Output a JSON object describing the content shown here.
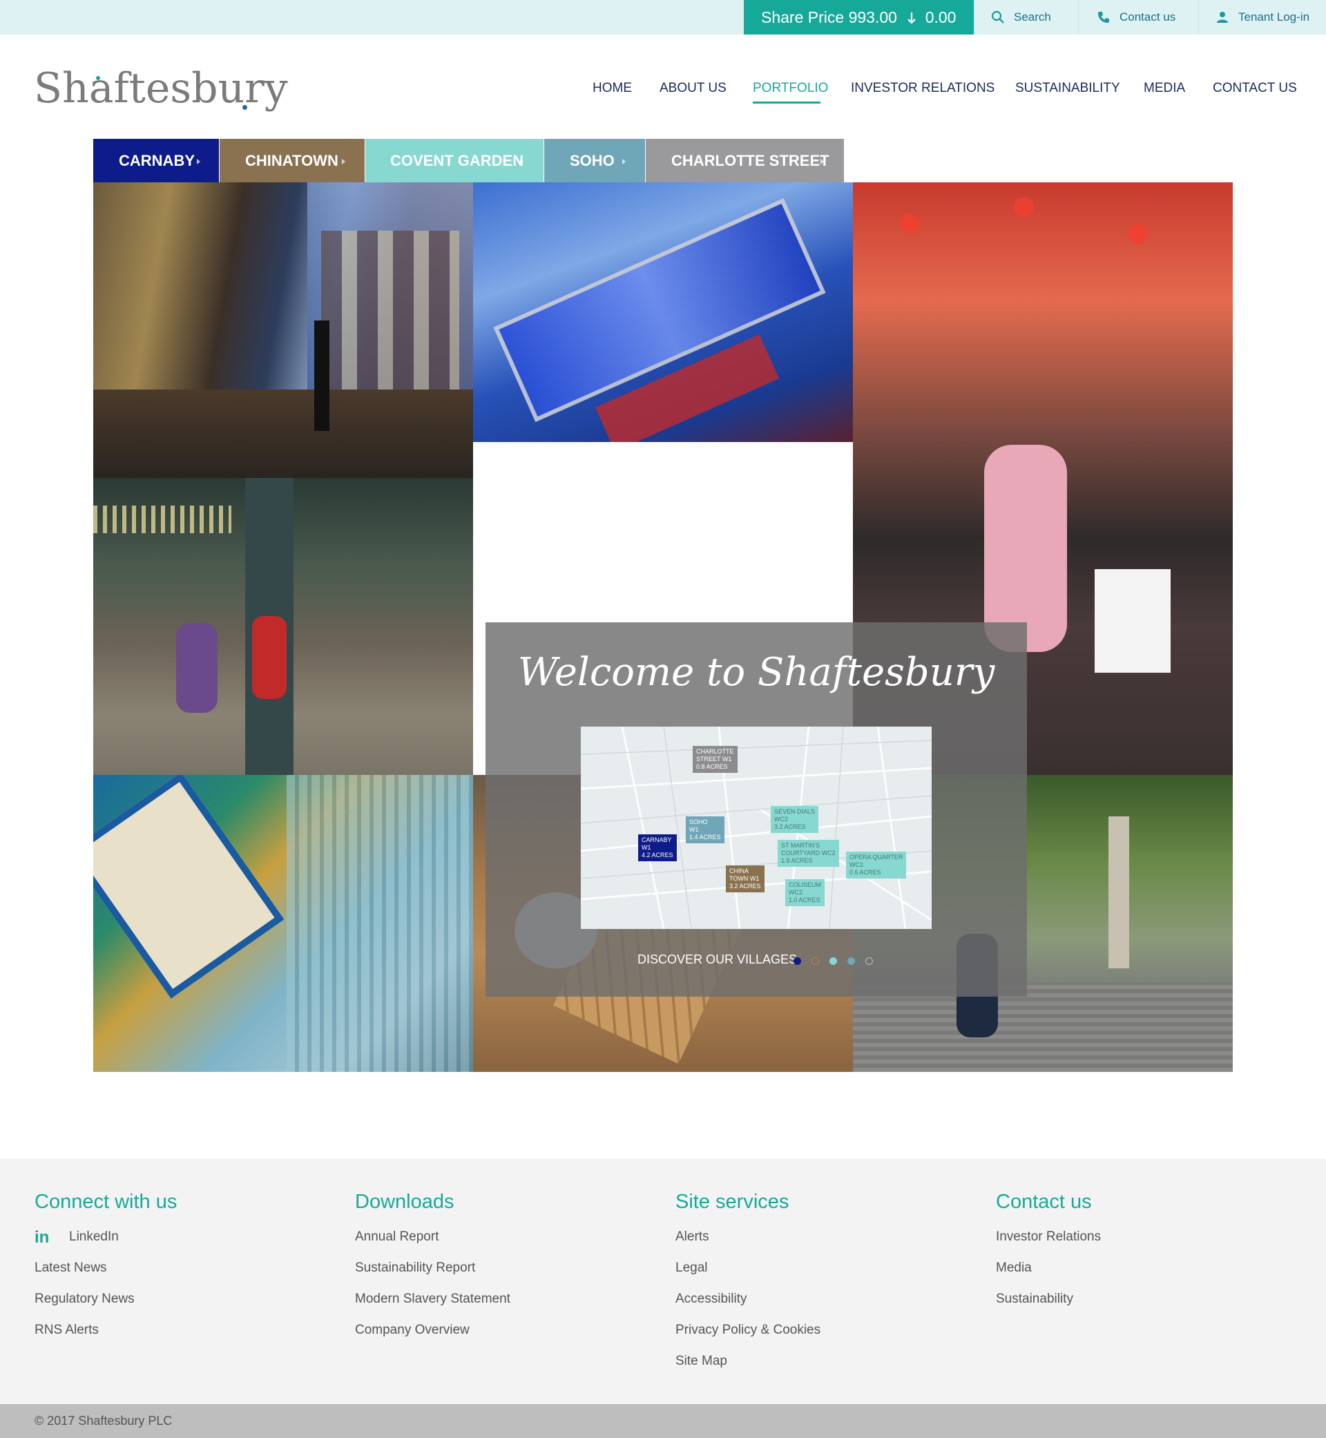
{
  "topbar": {
    "share_label": "Share Price",
    "share_value": "993.00",
    "share_change": "0.00",
    "search_label": "Search",
    "contact_label": "Contact us",
    "tenant_label": "Tenant Log-in"
  },
  "header": {
    "logo_text": "Shaftesbury"
  },
  "nav": {
    "items": [
      "HOME",
      "ABOUT US",
      "PORTFOLIO",
      "INVESTOR RELATIONS",
      "SUSTAINABILITY",
      "MEDIA",
      "CONTACT US"
    ],
    "active": "PORTFOLIO"
  },
  "village_tabs": [
    {
      "label": "CARNABY",
      "color": "#0d1c8a"
    },
    {
      "label": "CHINATOWN",
      "color": "#8a7251"
    },
    {
      "label": "COVENT GARDEN",
      "color": "#86d8d0"
    },
    {
      "label": "SOHO",
      "color": "#6fa6b8"
    },
    {
      "label": "CHARLOTTE STREET",
      "color": "#9a9a9c"
    }
  ],
  "hero": {
    "welcome_title": "Welcome to Shaftesbury",
    "cta": "DISCOVER OUR VILLAGES",
    "map_labels": {
      "charlotte": [
        "CHARLOTTE",
        "STREET W1",
        "0.8 ACRES"
      ],
      "soho": [
        "SOHO",
        "W1",
        "1.4 ACRES"
      ],
      "carnaby": [
        "CARNABY",
        "W1",
        "4.2 ACRES"
      ],
      "chinatown": [
        "CHINA",
        "TOWN W1",
        "3.2 ACRES"
      ],
      "seven_dials": [
        "SEVEN DIALS",
        "WC2",
        "3.2 ACRES"
      ],
      "st_martins": [
        "ST MARTIN'S",
        "COURTYARD WC2",
        "1.9 ACRES"
      ],
      "opera": [
        "OPERA QUARTER",
        "WC2",
        "0.6 ACRES"
      ],
      "coliseum": [
        "COLISEUM",
        "WC2",
        "1.0 ACRES"
      ]
    }
  },
  "footer": {
    "connect": {
      "title": "Connect with us",
      "links": [
        "LinkedIn",
        "Latest News",
        "Regulatory News",
        "RNS Alerts"
      ]
    },
    "downloads": {
      "title": "Downloads",
      "links": [
        "Annual Report",
        "Sustainability Report",
        "Modern Slavery Statement",
        "Company Overview"
      ]
    },
    "services": {
      "title": "Site services",
      "links": [
        "Alerts",
        "Legal",
        "Accessibility",
        "Privacy Policy & Cookies",
        "Site Map"
      ]
    },
    "contact": {
      "title": "Contact us",
      "links": [
        "Investor Relations",
        "Media",
        "Sustainability"
      ]
    },
    "copyright": "© 2017 Shaftesbury PLC"
  },
  "colors": {
    "accent": "#16a99a",
    "navy": "#1a2a5a",
    "topbar_bg": "#dff2f3",
    "footer_bg": "#f3f3f3"
  }
}
